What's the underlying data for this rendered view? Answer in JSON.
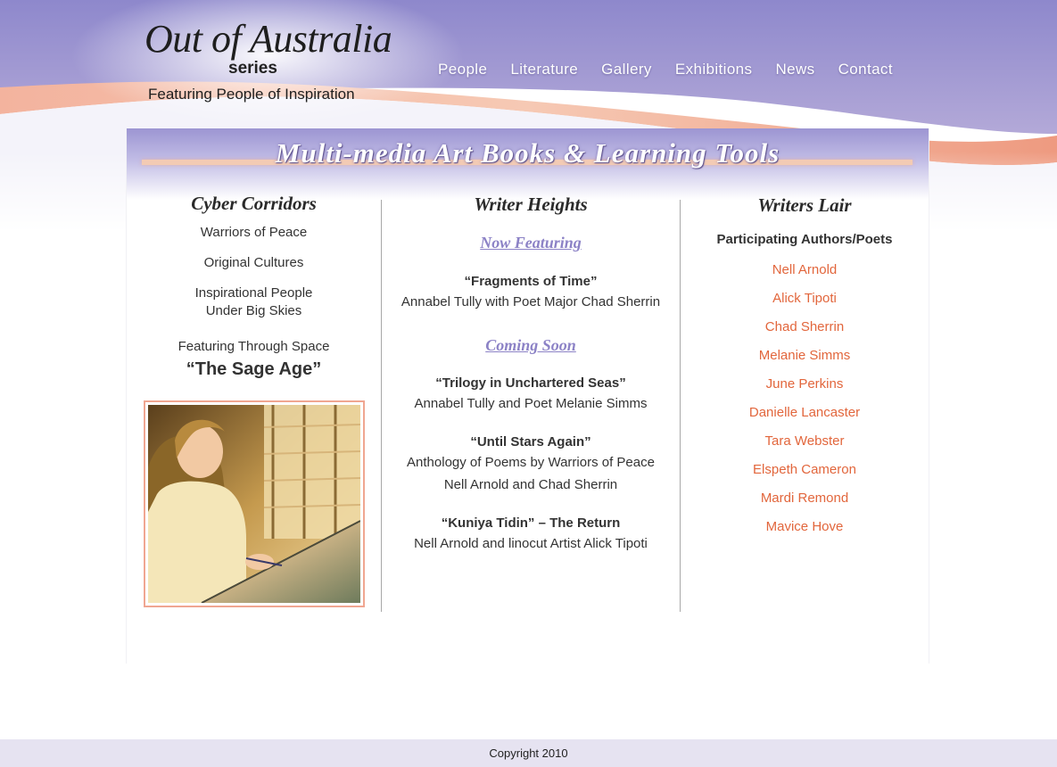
{
  "logo": {
    "title": "Out of Australia",
    "series": "series",
    "tagline": "Featuring People of Inspiration"
  },
  "nav": {
    "items": [
      "People",
      "Literature",
      "Gallery",
      "Exhibitions",
      "News",
      "Contact"
    ]
  },
  "banner": {
    "title": "Multi-media Art Books & Learning Tools"
  },
  "left_column": {
    "title": "Cyber Corridors",
    "items": [
      "Warriors of Peace",
      "Original Cultures"
    ],
    "inspirational_line1": "Inspirational People",
    "inspirational_line2": "Under Big Skies",
    "featuring_label": "Featuring Through Space",
    "featuring_title": "“The Sage Age”"
  },
  "middle_column": {
    "title": "Writer Heights",
    "now_featuring_label": "Now Featuring",
    "now_featuring": [
      {
        "title": "“Fragments of Time”",
        "line1": "Annabel Tully with Poet Major Chad Sherrin"
      }
    ],
    "coming_soon_label": "Coming Soon",
    "coming_soon": [
      {
        "title": "“Trilogy in Unchartered Seas”",
        "line1": "Annabel Tully and Poet Melanie Simms"
      },
      {
        "title": "“Until Stars Again”",
        "line1": "Anthology of Poems by Warriors of Peace",
        "line2": "Nell Arnold and Chad Sherrin"
      },
      {
        "title": "“Kuniya Tidin” – The Return",
        "line1": "Nell Arnold and linocut Artist Alick Tipoti"
      }
    ]
  },
  "right_column": {
    "title": "Writers Lair",
    "subtitle": "Participating Authors/Poets",
    "authors": [
      "Nell Arnold",
      "Alick Tipoti",
      "Chad Sherrin",
      "Melanie Simms",
      "June Perkins",
      "Danielle Lancaster",
      "Tara Webster",
      "Elspeth Cameron",
      "Mardi Remond",
      "Mavice Hove"
    ]
  },
  "footer": {
    "copyright": "Copyright 2010"
  },
  "colors": {
    "accent_orange": "#e2663c",
    "subhead_purple": "#8c82c6",
    "header_purple": "#8c8fd0",
    "header_peach": "#f0a48a"
  }
}
